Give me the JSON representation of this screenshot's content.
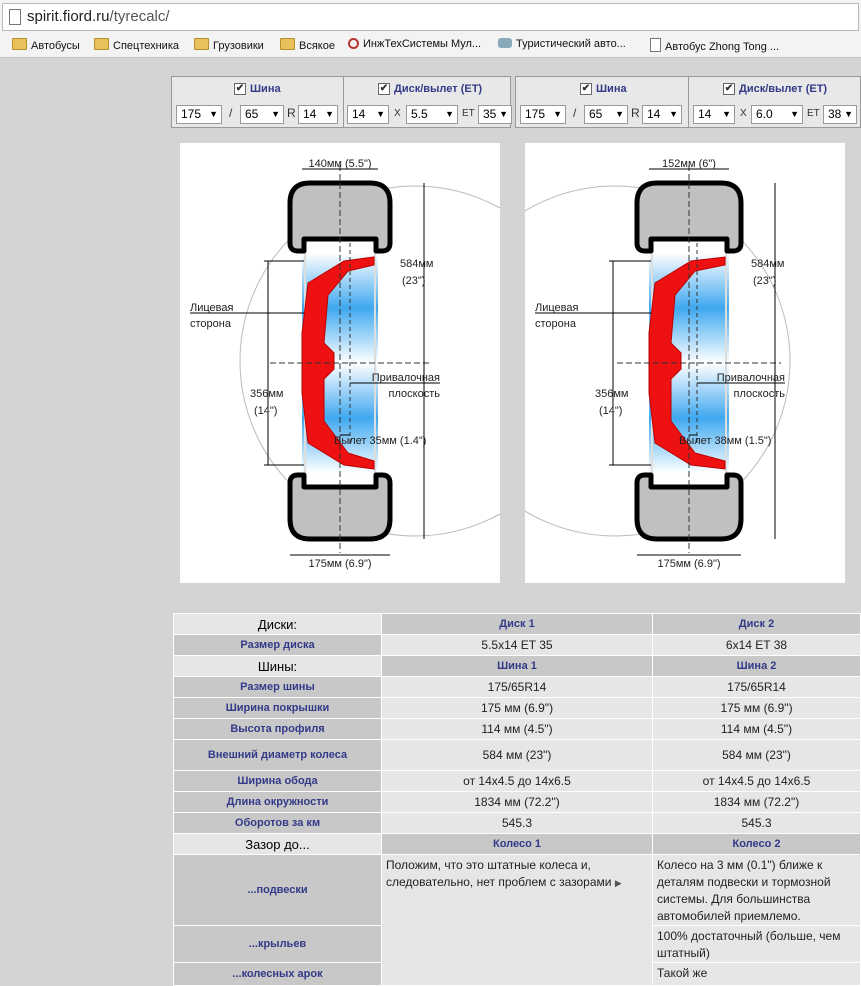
{
  "browser": {
    "url_host": "spirit.fiord.ru",
    "url_path": "/tyrecalc/",
    "bookmarks": [
      {
        "icon": "folder-icon",
        "label": "Автобусы"
      },
      {
        "icon": "folder-icon",
        "label": "Спецтехника"
      },
      {
        "icon": "folder-icon",
        "label": "Грузовики"
      },
      {
        "icon": "folder-icon",
        "label": "Всякое"
      },
      {
        "icon": "globe-icon",
        "label": "ИнжТехСистемы Мул..."
      },
      {
        "icon": "bus-icon",
        "label": "Туристический авто..."
      },
      {
        "icon": "page-icon",
        "label": "Автобус Zhong Tong ..."
      }
    ]
  },
  "controls": [
    {
      "tire_label": "Шина",
      "disk_label": "Диск/вылет (ET)",
      "tire_width": "175",
      "tire_profile": "65",
      "r_label": "R",
      "tire_diameter": "14",
      "disk_diameter": "14",
      "x_label": "X",
      "disk_width": "5.5",
      "et_label": "ET",
      "et": "35"
    },
    {
      "tire_label": "Шина",
      "disk_label": "Диск/вылет (ET)",
      "tire_width": "175",
      "tire_profile": "65",
      "r_label": "R",
      "tire_diameter": "14",
      "disk_diameter": "14",
      "x_label": "X",
      "disk_width": "6.0",
      "et_label": "ET",
      "et": "38"
    }
  ],
  "diagrams": [
    {
      "top_width": "140мм (5.5\")",
      "outer_diam_mm": "584мм",
      "outer_diam_in": "(23\")",
      "face_label_1": "Лицевая",
      "face_label_2": "сторона",
      "rim_diam_mm": "356мм",
      "rim_diam_in": "(14\")",
      "plane_label_1": "Привалочная",
      "plane_label_2": "плоскость",
      "offset": "Вылет 35мм (1.4\")",
      "bottom_width": "175мм (6.9\")"
    },
    {
      "top_width": "152мм (6\")",
      "outer_diam_mm": "584мм",
      "outer_diam_in": "(23\")",
      "face_label_1": "Лицевая",
      "face_label_2": "сторона",
      "rim_diam_mm": "356мм",
      "rim_diam_in": "(14\")",
      "plane_label_1": "Привалочная",
      "plane_label_2": "плоскость",
      "offset": "Вылет 38мм (1.5\")",
      "bottom_width": "175мм (6.9\")"
    }
  ],
  "table": {
    "disks_header": "Диски:",
    "disk1": "Диск 1",
    "disk2": "Диск 2",
    "disk_size_label": "Размер диска",
    "disk_size_1": "5.5x14 ET 35",
    "disk_size_2": "6x14 ET 38",
    "tires_header": "Шины:",
    "tire1": "Шина 1",
    "tire2": "Шина 2",
    "rows": [
      {
        "label": "Размер шины",
        "v1": "175/65R14",
        "v2": "175/65R14"
      },
      {
        "label": "Ширина покрышки",
        "v1": "175 мм (6.9\")",
        "v2": "175 мм (6.9\")"
      },
      {
        "label": "Высота профиля",
        "v1": "114 мм (4.5\")",
        "v2": "114 мм (4.5\")"
      },
      {
        "label": "Внешний диаметр колеса",
        "v1": "584 мм (23\")",
        "v2": "584 мм (23\")"
      },
      {
        "label": "Ширина обода",
        "v1": "от 14x4.5 до 14x6.5",
        "v2": "от 14x4.5 до 14x6.5"
      },
      {
        "label": "Длина окружности",
        "v1": "1834 мм (72.2\")",
        "v2": "1834 мм (72.2\")"
      },
      {
        "label": "Оборотов за км",
        "v1": "545.3",
        "v2": "545.3"
      }
    ],
    "gap_header": "Зазор до...",
    "wheel1": "Колесо 1",
    "wheel2": "Колесо 2",
    "suspension_label": "...подвески",
    "fenders_label": "...крыльев",
    "arches_label": "...колесных арок",
    "wheel1_text": "Положим, что это штатные колеса и, следовательно, нет проблем с зазорами",
    "wheel2_suspension": "Колесо на 3 мм (0.1\") ближе к деталям подвески и тормозной системы. Для большинства автомобилей приемлемо.",
    "wheel2_fenders": "100% достаточный (больше, чем штатный)",
    "wheel2_arches": "Такой же"
  }
}
